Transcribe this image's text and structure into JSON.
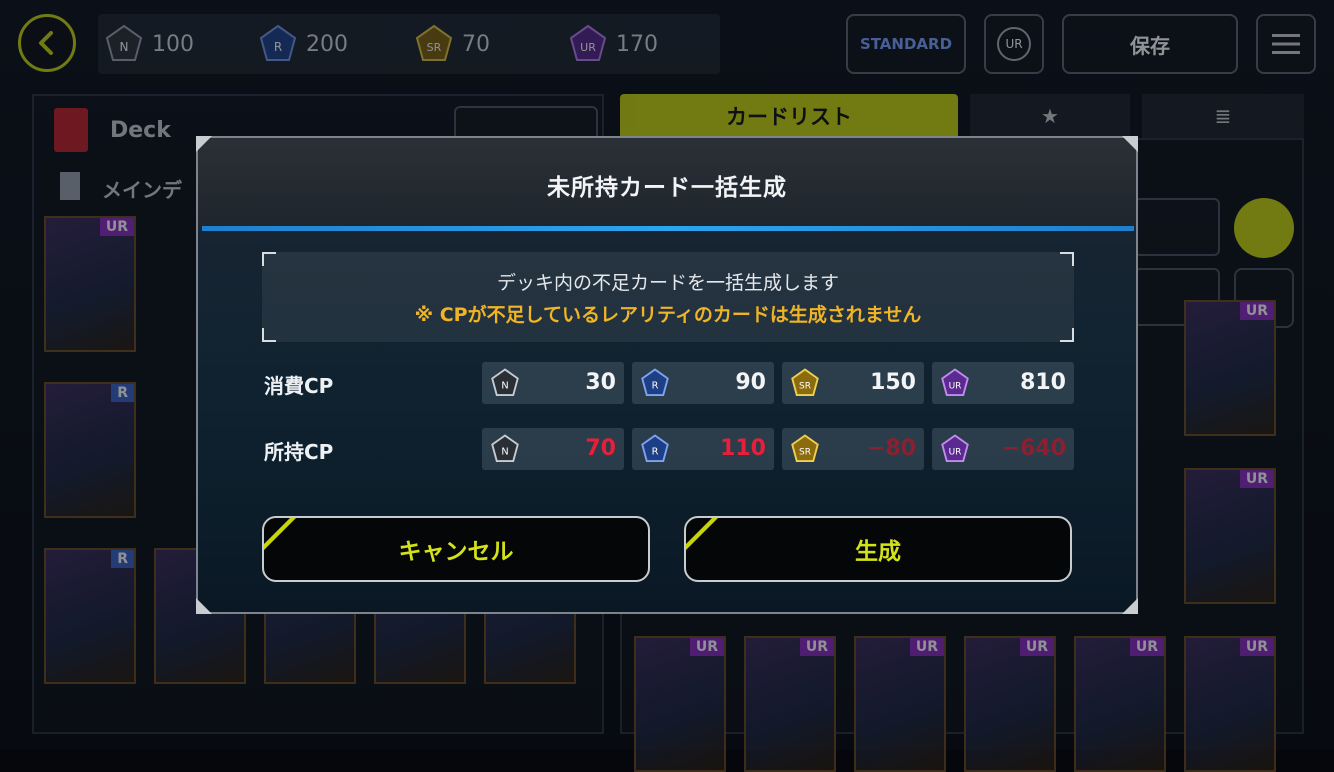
{
  "topbar": {
    "cp": [
      {
        "rarity": "N",
        "value": "100",
        "color": "#7d8590"
      },
      {
        "rarity": "R",
        "value": "200",
        "color": "#2e5ab8"
      },
      {
        "rarity": "SR",
        "value": "70",
        "color": "#c7a21a"
      },
      {
        "rarity": "UR",
        "value": "170",
        "color": "#8a3ec8"
      }
    ],
    "format_badge": "STANDARD",
    "ur_label": "UR",
    "save_label": "保存"
  },
  "deck": {
    "name": "Deck",
    "main_label": "メインデ"
  },
  "list": {
    "tab_cardlist": "カードリスト",
    "tab_fav": "★",
    "tab_memo": "≣",
    "cards": [
      {
        "rarity": "UR"
      },
      {
        "rarity": "UR"
      },
      {
        "rarity": "UR"
      },
      {
        "rarity": "UR"
      },
      {
        "rarity": "UR"
      },
      {
        "rarity": "UR"
      }
    ]
  },
  "dialog": {
    "title": "未所持カード一括生成",
    "notice_main": "デッキ内の不足カードを一括生成します",
    "notice_warn": "※ CPが不足しているレアリティのカードは生成されません",
    "rows": [
      {
        "label": "消費CP",
        "cells": [
          {
            "rarity": "N",
            "value": "30",
            "style": "normal"
          },
          {
            "rarity": "R",
            "value": "90",
            "style": "normal"
          },
          {
            "rarity": "SR",
            "value": "150",
            "style": "normal"
          },
          {
            "rarity": "UR",
            "value": "810",
            "style": "normal"
          }
        ]
      },
      {
        "label": "所持CP",
        "cells": [
          {
            "rarity": "N",
            "value": "70",
            "style": "red"
          },
          {
            "rarity": "R",
            "value": "110",
            "style": "red"
          },
          {
            "rarity": "SR",
            "value": "−80",
            "style": "dim"
          },
          {
            "rarity": "UR",
            "value": "−640",
            "style": "dim"
          }
        ]
      }
    ],
    "cancel_label": "キャンセル",
    "create_label": "生成"
  },
  "icons": {
    "back": "back-arrow-icon",
    "menu": "hamburger-menu-icon",
    "edit": "pencil-icon",
    "trash": "trash-icon",
    "view_toggle": "card-view-icon"
  },
  "colors": {
    "accent": "#c6d40e",
    "warn": "#f0b424",
    "negative": "#e81e3a"
  }
}
